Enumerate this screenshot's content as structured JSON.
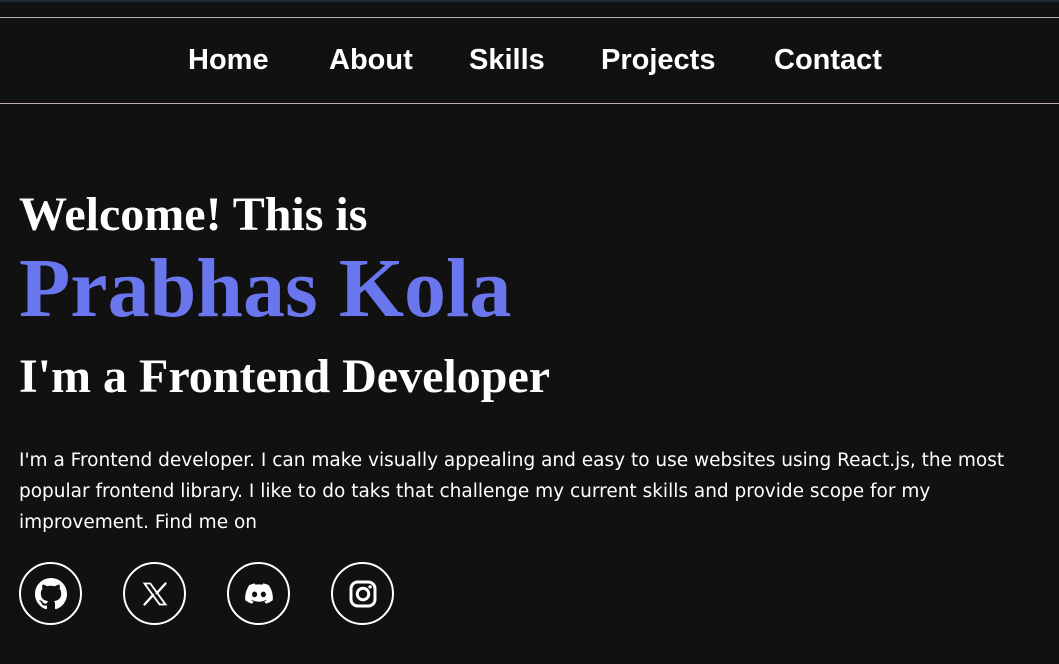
{
  "nav": {
    "items": [
      {
        "label": "Home"
      },
      {
        "label": "About"
      },
      {
        "label": "Skills"
      },
      {
        "label": "Projects"
      },
      {
        "label": "Contact"
      }
    ]
  },
  "hero": {
    "greeting": "Welcome! This is",
    "name": "Prabhas Kola",
    "role": "I'm a Frontend Developer",
    "bio": "I'm a Frontend developer. I can make visually appealing and easy to use websites using React.js, the most popular frontend library. I like to do taks that challenge my current skills and provide scope for my improvement. Find me on"
  },
  "socials": [
    {
      "icon": "github-icon"
    },
    {
      "icon": "x-icon"
    },
    {
      "icon": "discord-icon"
    },
    {
      "icon": "instagram-icon"
    }
  ],
  "colors": {
    "background": "#111111",
    "accent": "#6a76ee",
    "text": "#ffffff",
    "nav_border": "#bba8b6"
  }
}
